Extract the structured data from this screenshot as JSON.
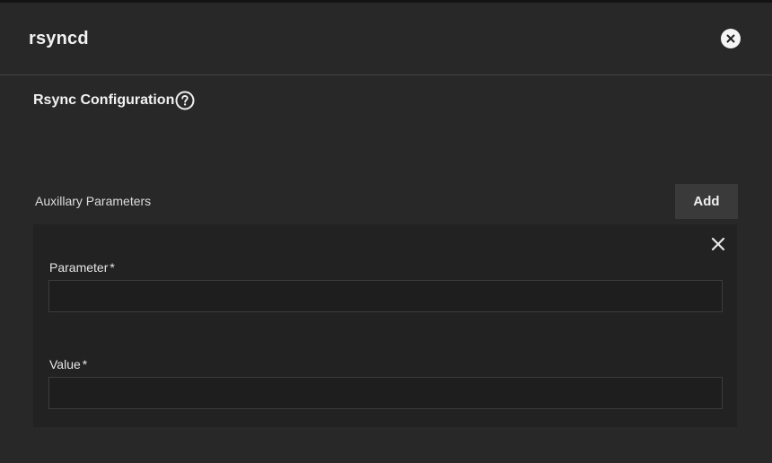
{
  "window": {
    "title": "rsyncd"
  },
  "section": {
    "title": "Rsync Configuration"
  },
  "aux": {
    "label": "Auxillary Parameters",
    "add_label": "Add"
  },
  "fields": {
    "parameter": {
      "label": "Parameter",
      "required_mark": "*",
      "value": "",
      "placeholder": ""
    },
    "value": {
      "label": "Value",
      "required_mark": "*",
      "value": "",
      "placeholder": ""
    }
  },
  "icons": {
    "close": "close-circle-icon",
    "help": "help-circle-icon",
    "remove": "close-icon"
  },
  "colors": {
    "background": "#282828",
    "card": "#222222",
    "button": "#3a3a3a",
    "text": "#e6e6e6"
  }
}
